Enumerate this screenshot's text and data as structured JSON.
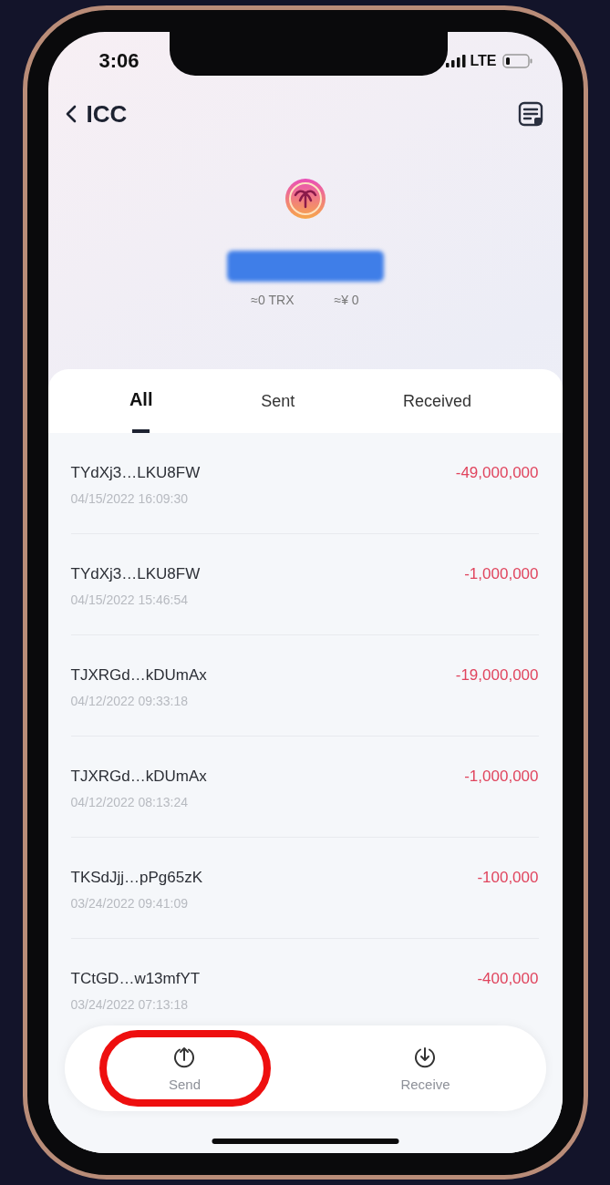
{
  "status_bar": {
    "time": "3:06",
    "network": "LTE"
  },
  "header": {
    "title": "ICC"
  },
  "balance": {
    "trx": "≈0 TRX",
    "fiat": "≈¥ 0"
  },
  "tabs": [
    {
      "label": "All",
      "selected": true
    },
    {
      "label": "Sent",
      "selected": false
    },
    {
      "label": "Received",
      "selected": false
    }
  ],
  "transactions": [
    {
      "address": "TYdXj3…LKU8FW",
      "time": "04/15/2022 16:09:30",
      "amount": "-49,000,000"
    },
    {
      "address": "TYdXj3…LKU8FW",
      "time": "04/15/2022 15:46:54",
      "amount": "-1,000,000"
    },
    {
      "address": "TJXRGd…kDUmAx",
      "time": "04/12/2022 09:33:18",
      "amount": "-19,000,000"
    },
    {
      "address": "TJXRGd…kDUmAx",
      "time": "04/12/2022 08:13:24",
      "amount": "-1,000,000"
    },
    {
      "address": "TKSdJjj…pPg65zK",
      "time": "03/24/2022 09:41:09",
      "amount": "-100,000"
    },
    {
      "address": "TCtGD…w13mfYT",
      "time": "03/24/2022 07:13:18",
      "amount": "-400,000"
    }
  ],
  "actions": [
    {
      "kind": "send",
      "label": "Send",
      "highlighted": true
    },
    {
      "kind": "receive",
      "label": "Receive",
      "highlighted": false
    }
  ]
}
